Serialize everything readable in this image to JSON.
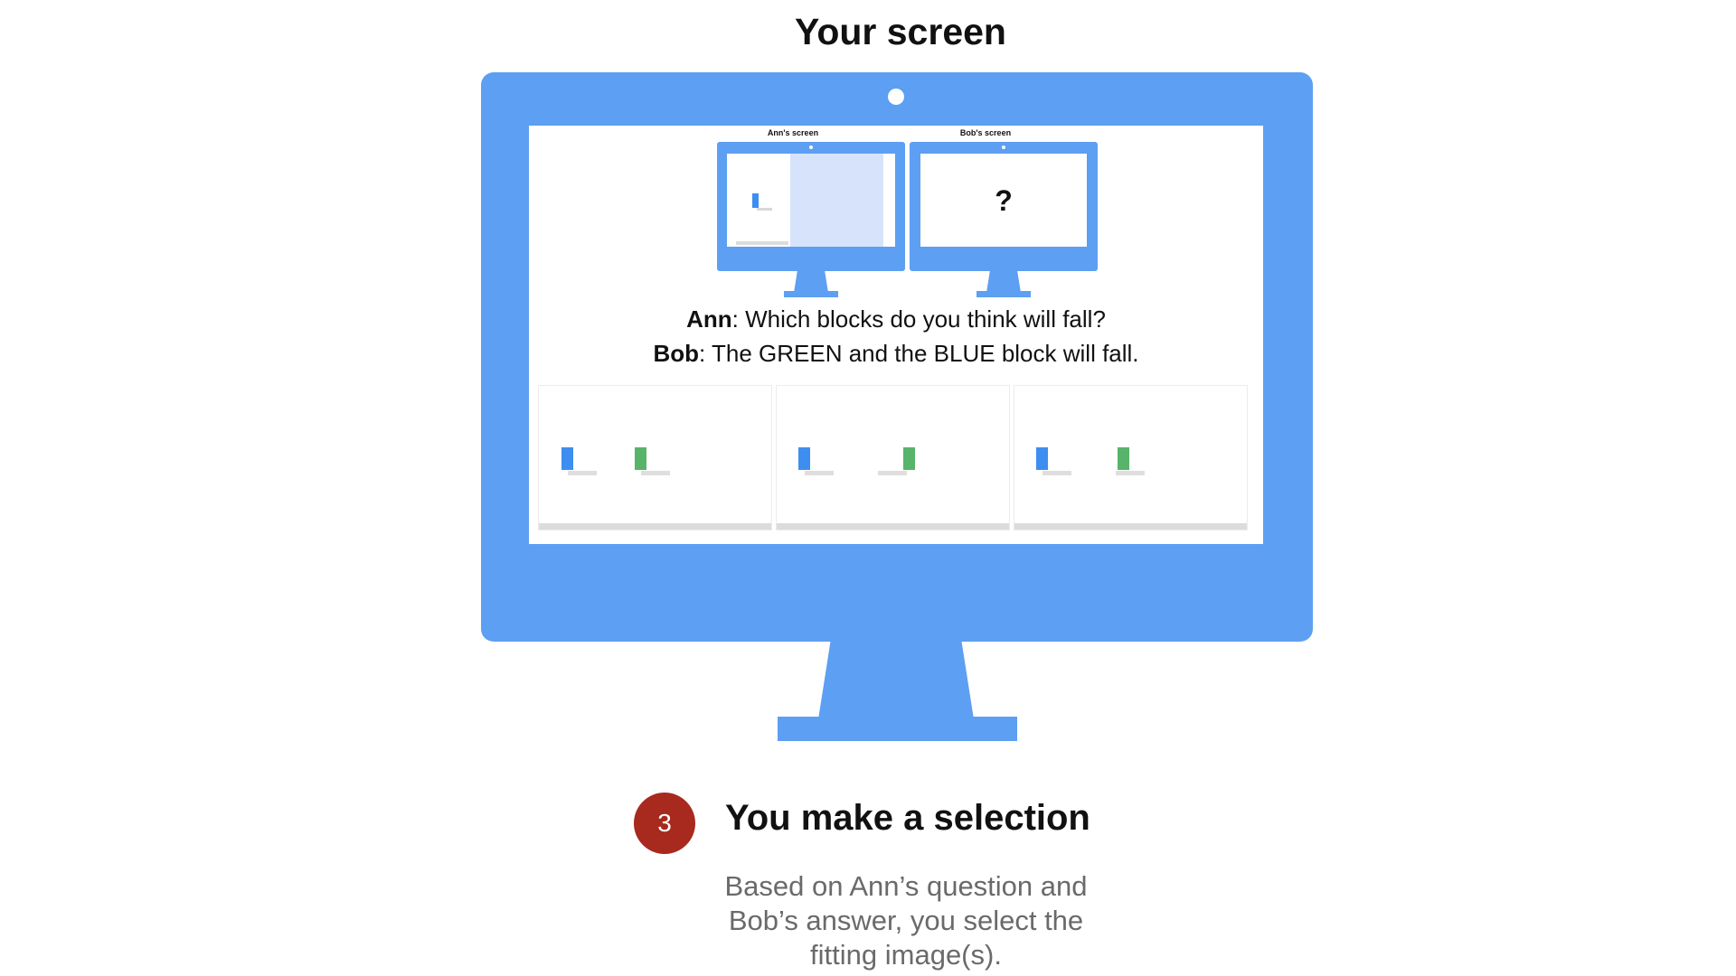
{
  "page_title": "Your screen",
  "mini_monitors": {
    "ann_title": "Ann's screen",
    "bob_title": "Bob's screen",
    "bob_placeholder": "?"
  },
  "dialogue": {
    "ann_speaker": "Ann",
    "ann_text": ": Which blocks do you think will fall?",
    "bob_speaker": "Bob",
    "bob_text": ": The GREEN and the BLUE block will fall."
  },
  "colors": {
    "monitor": "#5d9ff2",
    "block_blue": "#3d8ef0",
    "block_green": "#57b46a",
    "step_badge": "#a8291d"
  },
  "step": {
    "number": "3",
    "heading": "You make a selection",
    "description_lines": [
      "Based on Ann’s question and",
      "Bob’s answer, you select the",
      "fitting image(s)."
    ]
  }
}
